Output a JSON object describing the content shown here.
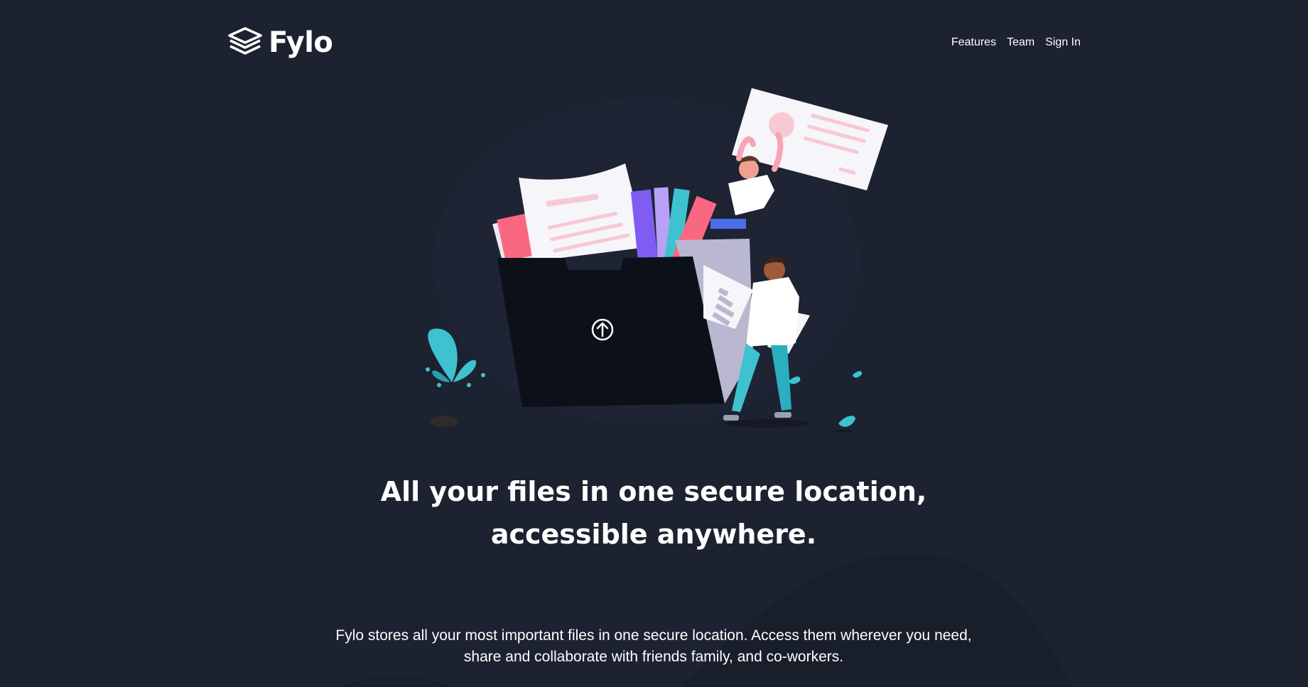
{
  "brand": {
    "name": "Fylo",
    "logo_icon": "stacked-layers-icon"
  },
  "nav": {
    "items": [
      {
        "label": "Features"
      },
      {
        "label": "Team"
      },
      {
        "label": "Sign In"
      }
    ]
  },
  "hero": {
    "illustration_icon": "upload-arrow-icon",
    "headline": "All your files in one secure location, accessible anywhere.",
    "description": "Fylo stores all your most important files in one secure location. Access them wherever you need, share and collaborate with friends family, and co-workers."
  },
  "colors": {
    "background": "#1c2230",
    "curve": "#181e2a",
    "folder": "#0c1019",
    "accent_pink": "#fa6780",
    "accent_teal": "#3ec2d0"
  }
}
